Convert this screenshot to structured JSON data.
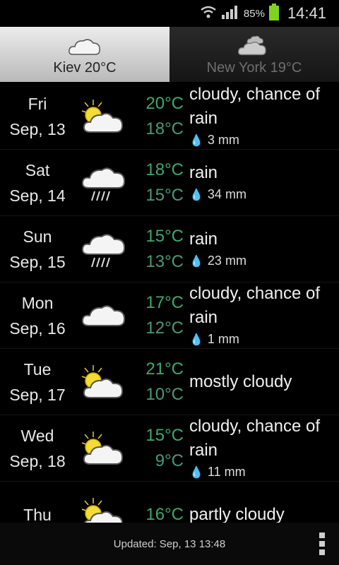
{
  "status": {
    "battery": "85%",
    "time": "14:41"
  },
  "tabs": [
    {
      "label": "Kiev  20°C",
      "active": true
    },
    {
      "label": "New York  19°C",
      "active": false
    }
  ],
  "forecast": [
    {
      "day": "Fri",
      "date": "Sep, 13",
      "icon": "partly-cloudy-icon",
      "high": "20°C",
      "low": "18°C",
      "desc": "cloudy, chance of rain",
      "precip": "3 mm"
    },
    {
      "day": "Sat",
      "date": "Sep, 14",
      "icon": "rain-icon",
      "high": "18°C",
      "low": "15°C",
      "desc": "rain",
      "precip": "34 mm"
    },
    {
      "day": "Sun",
      "date": "Sep, 15",
      "icon": "rain-icon",
      "high": "15°C",
      "low": "13°C",
      "desc": "rain",
      "precip": "23 mm"
    },
    {
      "day": "Mon",
      "date": "Sep, 16",
      "icon": "cloud-icon",
      "high": "17°C",
      "low": "12°C",
      "desc": "cloudy, chance of rain",
      "precip": "1 mm"
    },
    {
      "day": "Tue",
      "date": "Sep, 17",
      "icon": "partly-cloudy-icon",
      "high": "21°C",
      "low": "10°C",
      "desc": "mostly cloudy",
      "precip": ""
    },
    {
      "day": "Wed",
      "date": "Sep, 18",
      "icon": "partly-cloudy-icon",
      "high": "15°C",
      "low": "9°C",
      "desc": "cloudy, chance of rain",
      "precip": "11 mm"
    },
    {
      "day": "Thu",
      "date": "",
      "icon": "partly-cloudy-icon",
      "high": "16°C",
      "low": "",
      "desc": "partly cloudy",
      "precip": ""
    }
  ],
  "footer": {
    "updated": "Updated: Sep, 13 13:48"
  }
}
